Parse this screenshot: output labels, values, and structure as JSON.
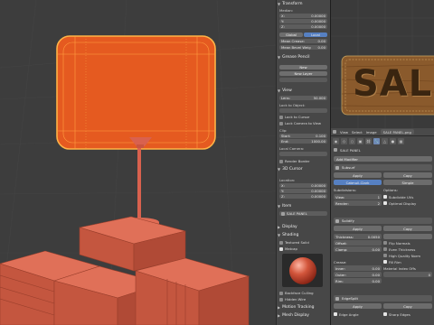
{
  "npanel": {
    "transform_header": "Transform",
    "median_label": "Median:",
    "median": [
      {
        "axis": "X:",
        "value": "0.00000"
      },
      {
        "axis": "Y:",
        "value": "0.00000"
      },
      {
        "axis": "Z:",
        "value": "0.00000"
      }
    ],
    "global_btn": "Global",
    "local_btn": "Local",
    "mean_crease": "Mean Crease:",
    "mean_crease_value": "0.00",
    "mean_bevel": "Mean Bevel Weig",
    "mean_bevel_value": "0.00",
    "grease_header": "Grease Pencil",
    "new_btn": "New",
    "new_layer_btn": "New Layer",
    "view_header": "View",
    "lens_label": "Lens:",
    "lens_value": "50.000",
    "lock_object": "Lock to Object:",
    "lock_cursor": "Lock to Cursor",
    "lock_camera": "Lock Camera to View",
    "clip_label": "Clip:",
    "clip_start_label": "Start:",
    "clip_start": "0.100",
    "clip_end_label": "End:",
    "clip_end": "1000.00",
    "local_camera": "Local Camera:",
    "render_border": "Render Border",
    "cursor_header": "3D Cursor",
    "location_label": "Location:",
    "cursor": [
      {
        "axis": "X:",
        "value": "0.00000"
      },
      {
        "axis": "Y:",
        "value": "0.00000"
      },
      {
        "axis": "Z:",
        "value": "0.00000"
      }
    ],
    "item_header": "Item",
    "item_name": "SALE PANEL",
    "display_header": "Display",
    "shading_header": "Shading",
    "textured_solid": "Textured Solid",
    "matcap_label": "Matcap",
    "backface_culling": "Backface Culling",
    "hidden_wire": "Hidden Wire",
    "motion_tracking": "Motion Tracking",
    "mesh_display": "Mesh Display"
  },
  "image_editor": {
    "sale_text": "SALE",
    "menu_view": "View",
    "menu_select": "Select",
    "menu_image": "Image",
    "image_name": "SALE PANEL.png",
    "colors": {
      "wood": "#8a5a2c",
      "sale_text": "#3a2510"
    }
  },
  "properties": {
    "object_name": "SALE PANEL",
    "add_modifier": "Add Modifier",
    "mod1_name": "Subsurf",
    "apply": "Apply",
    "copy": "Copy",
    "catmull": "Catmull-Clark",
    "simple": "Simple",
    "subdivisions": "Subdivisions:",
    "view_label": "View:",
    "view_value": "1",
    "render_label": "Render:",
    "render_value": "2",
    "options": "Options:",
    "subdivide_uvs": "Subdivide UVs",
    "optimal_display": "Optimal Display",
    "mod2_name": "Solidify",
    "thickness_label": "Thickness:",
    "thickness_value": "0.0050",
    "offset_label": "Offset:",
    "clamp_label": "Clamp:",
    "clamp_value": "0.00",
    "flip_normals": "Flip Normals",
    "even_thickness": "Even Thickness",
    "high_quality": "High Quality Norm",
    "fill_rim": "Fill Rim",
    "crease_label": "Crease:",
    "inner_label": "Inner:",
    "inner_value": "0.00",
    "outer_label": "Outer:",
    "outer_value": "0.00",
    "rim_label": "Rim:",
    "rim_value": "0.00",
    "material_index": "Material Index Offs",
    "mat_value": "0",
    "mod3_name": "EdgeSplit",
    "edge_angle": "Edge Angle",
    "sharp_edges": "Sharp Edges"
  },
  "viewport": {
    "colors": {
      "object": "#e55a20",
      "edge": "#ffb347",
      "stand": "#d9614e",
      "boxes": "#d0664f",
      "bg": "#3d3d3d"
    }
  }
}
